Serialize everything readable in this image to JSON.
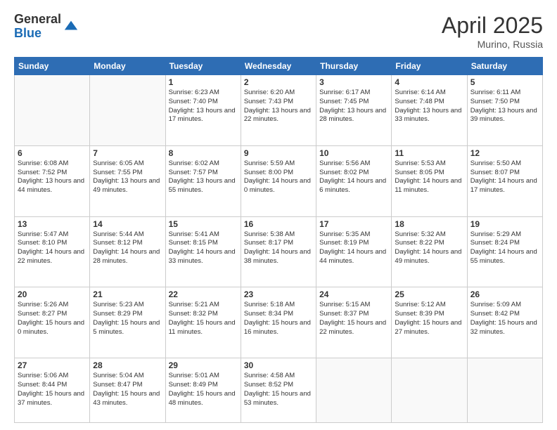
{
  "header": {
    "logo_general": "General",
    "logo_blue": "Blue",
    "month_title": "April 2025",
    "location": "Murino, Russia"
  },
  "weekdays": [
    "Sunday",
    "Monday",
    "Tuesday",
    "Wednesday",
    "Thursday",
    "Friday",
    "Saturday"
  ],
  "weeks": [
    [
      {
        "day": "",
        "info": ""
      },
      {
        "day": "",
        "info": ""
      },
      {
        "day": "1",
        "info": "Sunrise: 6:23 AM\nSunset: 7:40 PM\nDaylight: 13 hours and 17 minutes."
      },
      {
        "day": "2",
        "info": "Sunrise: 6:20 AM\nSunset: 7:43 PM\nDaylight: 13 hours and 22 minutes."
      },
      {
        "day": "3",
        "info": "Sunrise: 6:17 AM\nSunset: 7:45 PM\nDaylight: 13 hours and 28 minutes."
      },
      {
        "day": "4",
        "info": "Sunrise: 6:14 AM\nSunset: 7:48 PM\nDaylight: 13 hours and 33 minutes."
      },
      {
        "day": "5",
        "info": "Sunrise: 6:11 AM\nSunset: 7:50 PM\nDaylight: 13 hours and 39 minutes."
      }
    ],
    [
      {
        "day": "6",
        "info": "Sunrise: 6:08 AM\nSunset: 7:52 PM\nDaylight: 13 hours and 44 minutes."
      },
      {
        "day": "7",
        "info": "Sunrise: 6:05 AM\nSunset: 7:55 PM\nDaylight: 13 hours and 49 minutes."
      },
      {
        "day": "8",
        "info": "Sunrise: 6:02 AM\nSunset: 7:57 PM\nDaylight: 13 hours and 55 minutes."
      },
      {
        "day": "9",
        "info": "Sunrise: 5:59 AM\nSunset: 8:00 PM\nDaylight: 14 hours and 0 minutes."
      },
      {
        "day": "10",
        "info": "Sunrise: 5:56 AM\nSunset: 8:02 PM\nDaylight: 14 hours and 6 minutes."
      },
      {
        "day": "11",
        "info": "Sunrise: 5:53 AM\nSunset: 8:05 PM\nDaylight: 14 hours and 11 minutes."
      },
      {
        "day": "12",
        "info": "Sunrise: 5:50 AM\nSunset: 8:07 PM\nDaylight: 14 hours and 17 minutes."
      }
    ],
    [
      {
        "day": "13",
        "info": "Sunrise: 5:47 AM\nSunset: 8:10 PM\nDaylight: 14 hours and 22 minutes."
      },
      {
        "day": "14",
        "info": "Sunrise: 5:44 AM\nSunset: 8:12 PM\nDaylight: 14 hours and 28 minutes."
      },
      {
        "day": "15",
        "info": "Sunrise: 5:41 AM\nSunset: 8:15 PM\nDaylight: 14 hours and 33 minutes."
      },
      {
        "day": "16",
        "info": "Sunrise: 5:38 AM\nSunset: 8:17 PM\nDaylight: 14 hours and 38 minutes."
      },
      {
        "day": "17",
        "info": "Sunrise: 5:35 AM\nSunset: 8:19 PM\nDaylight: 14 hours and 44 minutes."
      },
      {
        "day": "18",
        "info": "Sunrise: 5:32 AM\nSunset: 8:22 PM\nDaylight: 14 hours and 49 minutes."
      },
      {
        "day": "19",
        "info": "Sunrise: 5:29 AM\nSunset: 8:24 PM\nDaylight: 14 hours and 55 minutes."
      }
    ],
    [
      {
        "day": "20",
        "info": "Sunrise: 5:26 AM\nSunset: 8:27 PM\nDaylight: 15 hours and 0 minutes."
      },
      {
        "day": "21",
        "info": "Sunrise: 5:23 AM\nSunset: 8:29 PM\nDaylight: 15 hours and 5 minutes."
      },
      {
        "day": "22",
        "info": "Sunrise: 5:21 AM\nSunset: 8:32 PM\nDaylight: 15 hours and 11 minutes."
      },
      {
        "day": "23",
        "info": "Sunrise: 5:18 AM\nSunset: 8:34 PM\nDaylight: 15 hours and 16 minutes."
      },
      {
        "day": "24",
        "info": "Sunrise: 5:15 AM\nSunset: 8:37 PM\nDaylight: 15 hours and 22 minutes."
      },
      {
        "day": "25",
        "info": "Sunrise: 5:12 AM\nSunset: 8:39 PM\nDaylight: 15 hours and 27 minutes."
      },
      {
        "day": "26",
        "info": "Sunrise: 5:09 AM\nSunset: 8:42 PM\nDaylight: 15 hours and 32 minutes."
      }
    ],
    [
      {
        "day": "27",
        "info": "Sunrise: 5:06 AM\nSunset: 8:44 PM\nDaylight: 15 hours and 37 minutes."
      },
      {
        "day": "28",
        "info": "Sunrise: 5:04 AM\nSunset: 8:47 PM\nDaylight: 15 hours and 43 minutes."
      },
      {
        "day": "29",
        "info": "Sunrise: 5:01 AM\nSunset: 8:49 PM\nDaylight: 15 hours and 48 minutes."
      },
      {
        "day": "30",
        "info": "Sunrise: 4:58 AM\nSunset: 8:52 PM\nDaylight: 15 hours and 53 minutes."
      },
      {
        "day": "",
        "info": ""
      },
      {
        "day": "",
        "info": ""
      },
      {
        "day": "",
        "info": ""
      }
    ]
  ]
}
